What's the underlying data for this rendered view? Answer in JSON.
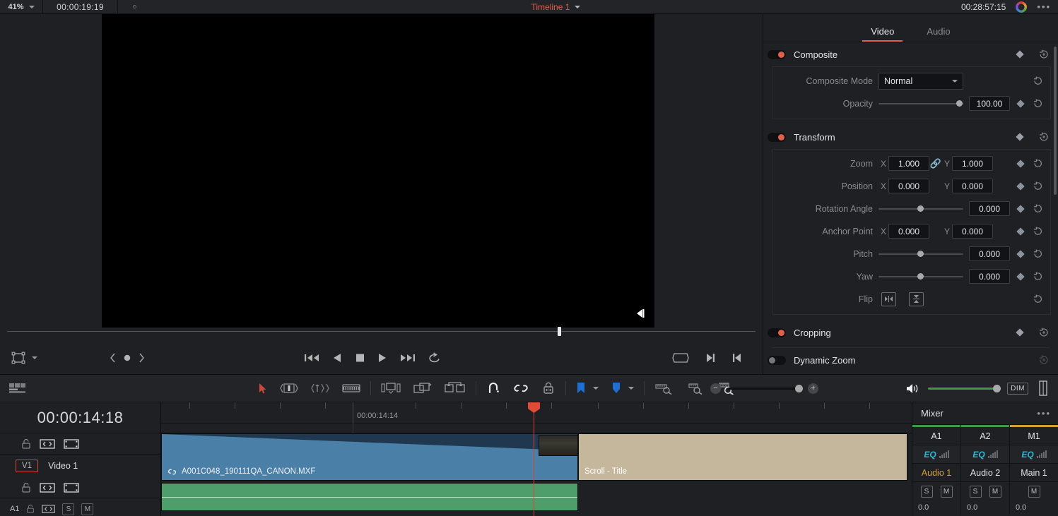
{
  "topbar": {
    "zoom_level": "41%",
    "timecode_left": "00:00:19:19",
    "timeline_name": "Timeline 1",
    "timecode_right": "00:28:57:15",
    "options_label": "•••"
  },
  "inspector": {
    "tabs": [
      {
        "label": "Video",
        "active": true
      },
      {
        "label": "Audio",
        "active": false
      }
    ],
    "sections": [
      {
        "title": "Composite",
        "enabled": true,
        "rows": [
          {
            "label": "Composite Mode",
            "type": "select",
            "value": "Normal"
          },
          {
            "label": "Opacity",
            "type": "slider_num",
            "value": "100.00",
            "knob_pct": 92
          }
        ]
      },
      {
        "title": "Transform",
        "enabled": true,
        "rows": [
          {
            "label": "Zoom",
            "type": "xy",
            "x": "1.000",
            "y": "1.000",
            "linked": true
          },
          {
            "label": "Position",
            "type": "xy",
            "x": "0.000",
            "y": "0.000",
            "linked": false
          },
          {
            "label": "Rotation Angle",
            "type": "slider_num",
            "value": "0.000",
            "knob_pct": 50
          },
          {
            "label": "Anchor Point",
            "type": "xy",
            "x": "0.000",
            "y": "0.000",
            "linked": false
          },
          {
            "label": "Pitch",
            "type": "slider_num",
            "value": "0.000",
            "knob_pct": 50
          },
          {
            "label": "Yaw",
            "type": "slider_num",
            "value": "0.000",
            "knob_pct": 50
          },
          {
            "label": "Flip",
            "type": "flip"
          }
        ]
      },
      {
        "title": "Cropping",
        "enabled": true,
        "rows": []
      },
      {
        "title": "Dynamic Zoom",
        "enabled": false,
        "rows": []
      }
    ]
  },
  "viewer": {
    "transport_icons": [
      "jump-to-start-icon",
      "play-reverse-icon",
      "stop-icon",
      "play-icon",
      "jump-to-end-icon",
      "loop-icon"
    ],
    "right_icons": [
      "fit-screen-icon",
      "next-edit-icon",
      "prev-edit-icon"
    ],
    "overlay_icon": "mark-out-icon",
    "annotation_icons": [
      "prev-marker-icon",
      "marker-dot-icon",
      "next-marker-icon"
    ],
    "mode_icon": "transform-box-icon"
  },
  "toolbar": {
    "left_icon": "timeline-view-options-icon",
    "tools": [
      "selection-mode-icon",
      "trim-edit-mode-icon",
      "dynamic-trim-mode-icon",
      "blade-edit-mode-icon",
      "insert-clip-icon",
      "overwrite-clip-icon",
      "replace-clip-icon",
      "snapping-icon",
      "linked-selection-icon",
      "lock-track-icon",
      "marker-icon",
      "flag-icon",
      "fit-timeline-icon",
      "detail-zoom-icon",
      "custom-zoom-icon"
    ],
    "zoom_minus": "−",
    "zoom_plus": "+",
    "audio_icon": "speaker-icon",
    "dim_label": "DIM",
    "meter_icon": "audio-meter-icon"
  },
  "timeline": {
    "playhead_timecode": "00:00:14:18",
    "ruler_label": "00:00:14:14",
    "tracks": [
      {
        "id": "V1",
        "name": "Video 1",
        "header_icons": [
          "lock-icon",
          "auto-select-icon",
          "video-visibility-icon"
        ],
        "clips": [
          {
            "name": "A001C048_190111QA_CANON.MXF",
            "type": "video",
            "link_icon": "link-icon"
          },
          {
            "name": "Scroll - Title",
            "type": "title"
          }
        ]
      },
      {
        "id": "A1",
        "name": "Audio 1",
        "clips": [
          {
            "name": "",
            "type": "audio"
          }
        ]
      }
    ]
  },
  "mixer": {
    "title": "Mixer",
    "options_label": "•••",
    "channels": [
      {
        "id": "A1",
        "eq": "EQ",
        "track": "Audio 1",
        "buttons": [
          "S",
          "M"
        ],
        "db": "0.0",
        "color": "#3a9a4a",
        "highlight": true
      },
      {
        "id": "A2",
        "eq": "EQ",
        "track": "Audio 2",
        "buttons": [
          "S",
          "M"
        ],
        "db": "0.0",
        "color": "#3a9a4a",
        "highlight": false
      },
      {
        "id": "M1",
        "eq": "EQ",
        "track": "Main 1",
        "buttons": [
          "M"
        ],
        "db": "0.0",
        "color": "#d2a02c",
        "highlight": false
      }
    ]
  },
  "colors": {
    "accent_red": "#e0604a",
    "playhead": "#d0473a",
    "clip_video": "#4a7fa8",
    "clip_title": "#c5b79c",
    "clip_audio": "#4d9e6a",
    "audio_green": "#3a9a4a",
    "main_gold": "#d2a02c",
    "eq_cyan": "#2fb8d6"
  }
}
